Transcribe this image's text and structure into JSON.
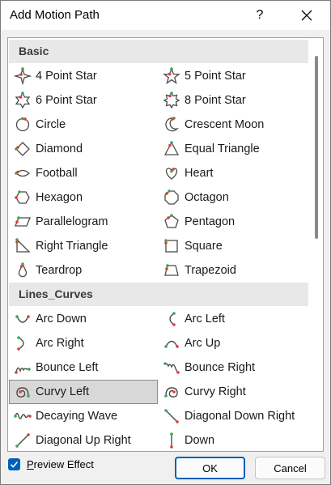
{
  "dialog": {
    "title": "Add Motion Path",
    "help_label": "?",
    "close_label": "✕"
  },
  "sections": [
    {
      "header": "Basic",
      "items": [
        {
          "label": "4 Point Star",
          "icon": "4-point-star-icon"
        },
        {
          "label": "5 Point Star",
          "icon": "5-point-star-icon"
        },
        {
          "label": "6 Point Star",
          "icon": "6-point-star-icon"
        },
        {
          "label": "8 Point Star",
          "icon": "8-point-star-icon"
        },
        {
          "label": "Circle",
          "icon": "circle-icon"
        },
        {
          "label": "Crescent Moon",
          "icon": "crescent-moon-icon"
        },
        {
          "label": "Diamond",
          "icon": "diamond-icon"
        },
        {
          "label": "Equal Triangle",
          "icon": "equal-triangle-icon"
        },
        {
          "label": "Football",
          "icon": "football-icon"
        },
        {
          "label": "Heart",
          "icon": "heart-icon"
        },
        {
          "label": "Hexagon",
          "icon": "hexagon-icon"
        },
        {
          "label": "Octagon",
          "icon": "octagon-icon"
        },
        {
          "label": "Parallelogram",
          "icon": "parallelogram-icon"
        },
        {
          "label": "Pentagon",
          "icon": "pentagon-icon"
        },
        {
          "label": "Right Triangle",
          "icon": "right-triangle-icon"
        },
        {
          "label": "Square",
          "icon": "square-icon"
        },
        {
          "label": "Teardrop",
          "icon": "teardrop-icon"
        },
        {
          "label": "Trapezoid",
          "icon": "trapezoid-icon"
        }
      ]
    },
    {
      "header": "Lines_Curves",
      "items": [
        {
          "label": "Arc Down",
          "icon": "arc-down-icon"
        },
        {
          "label": "Arc Left",
          "icon": "arc-left-icon"
        },
        {
          "label": "Arc Right",
          "icon": "arc-right-icon"
        },
        {
          "label": "Arc Up",
          "icon": "arc-up-icon"
        },
        {
          "label": "Bounce Left",
          "icon": "bounce-left-icon"
        },
        {
          "label": "Bounce Right",
          "icon": "bounce-right-icon"
        },
        {
          "label": "Curvy Left",
          "icon": "curvy-left-icon",
          "selected": true
        },
        {
          "label": "Curvy Right",
          "icon": "curvy-right-icon"
        },
        {
          "label": "Decaying Wave",
          "icon": "decaying-wave-icon"
        },
        {
          "label": "Diagonal Down Right",
          "icon": "diagonal-down-right-icon"
        },
        {
          "label": "Diagonal Up Right",
          "icon": "diagonal-up-right-icon"
        },
        {
          "label": "Down",
          "icon": "down-icon"
        }
      ]
    }
  ],
  "footer": {
    "preview_label": "Preview Effect",
    "preview_checked": true,
    "ok_label": "OK",
    "cancel_label": "Cancel"
  }
}
